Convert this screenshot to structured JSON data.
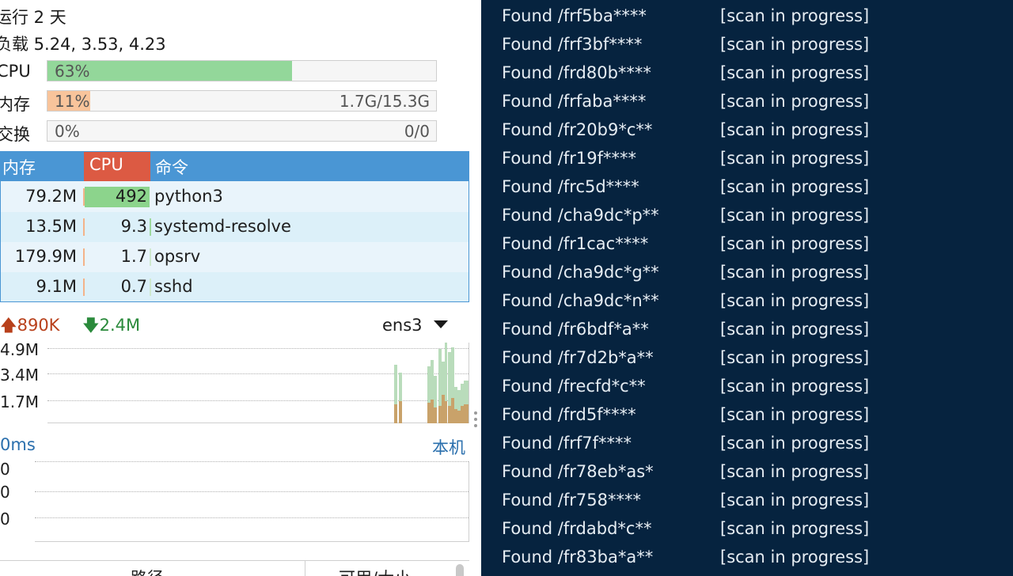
{
  "system": {
    "uptime_label": "运行 2 天",
    "load_label": "负载 5.24, 3.53, 4.23",
    "meters": [
      {
        "name": "CPU",
        "percent_text": "63%",
        "percent": 63,
        "right": "",
        "color": "#93d79a"
      },
      {
        "name": "内存",
        "percent_text": "11%",
        "percent": 11,
        "right": "1.7G/15.3G",
        "color": "#f8c49b"
      },
      {
        "name": "交换",
        "percent_text": "0%",
        "percent": 0,
        "right": "0/0",
        "color": "#cccccc"
      }
    ]
  },
  "process_table": {
    "headers": {
      "mem": "内存",
      "cpu": "CPU",
      "cmd": "命令"
    },
    "rows": [
      {
        "mem": "79.2M",
        "cpu": "492",
        "cmd": "python3",
        "cpu_share": 1.0
      },
      {
        "mem": "13.5M",
        "cpu": "9.3",
        "cmd": "systemd-resolve",
        "cpu_share": 0.02
      },
      {
        "mem": "179.9M",
        "cpu": "1.7",
        "cmd": "opsrv",
        "cpu_share": 0
      },
      {
        "mem": "9.1M",
        "cpu": "0.7",
        "cmd": "sshd",
        "cpu_share": 0
      }
    ]
  },
  "network": {
    "up": "890K",
    "down": "2.4M",
    "interface": "ens3",
    "y_labels": [
      "4.9M",
      "3.4M",
      "1.7M"
    ]
  },
  "latency": {
    "ms_label": "0ms",
    "host_label": "本机",
    "y_labels": [
      "0",
      "0",
      "0"
    ]
  },
  "lower_table": {
    "col1": "路径",
    "col2": "可用/大小"
  },
  "terminal": {
    "lines": [
      {
        "path": "Found /frf5ba****",
        "status": "[scan in progress]"
      },
      {
        "path": "Found /frf3bf****",
        "status": "[scan in progress]"
      },
      {
        "path": "Found /frd80b****",
        "status": "[scan in progress]"
      },
      {
        "path": "Found /frfaba****",
        "status": "[scan in progress]"
      },
      {
        "path": "Found /fr20b9*c**",
        "status": "[scan in progress]"
      },
      {
        "path": "Found /fr19f****",
        "status": "[scan in progress]"
      },
      {
        "path": "Found /frc5d****",
        "status": "[scan in progress]"
      },
      {
        "path": "Found /cha9dc*p**",
        "status": "[scan in progress]"
      },
      {
        "path": "Found /fr1cac****",
        "status": "[scan in progress]"
      },
      {
        "path": "Found /cha9dc*g**",
        "status": "[scan in progress]"
      },
      {
        "path": "Found /cha9dc*n**",
        "status": "[scan in progress]"
      },
      {
        "path": "Found /fr6bdf*a**",
        "status": "[scan in progress]"
      },
      {
        "path": "Found /fr7d2b*a**",
        "status": "[scan in progress]"
      },
      {
        "path": "Found /frecfd*c**",
        "status": "[scan in progress]"
      },
      {
        "path": "Found /frd5f****",
        "status": "[scan in progress]"
      },
      {
        "path": "Found /frf7f****",
        "status": "[scan in progress]"
      },
      {
        "path": "Found /fr78eb*as*",
        "status": "[scan in progress]"
      },
      {
        "path": "Found /fr758****",
        "status": "[scan in progress]"
      },
      {
        "path": "Found /frdabd*c**",
        "status": "[scan in progress]"
      },
      {
        "path": "Found /fr83ba*a**",
        "status": "[scan in progress]"
      }
    ]
  }
}
